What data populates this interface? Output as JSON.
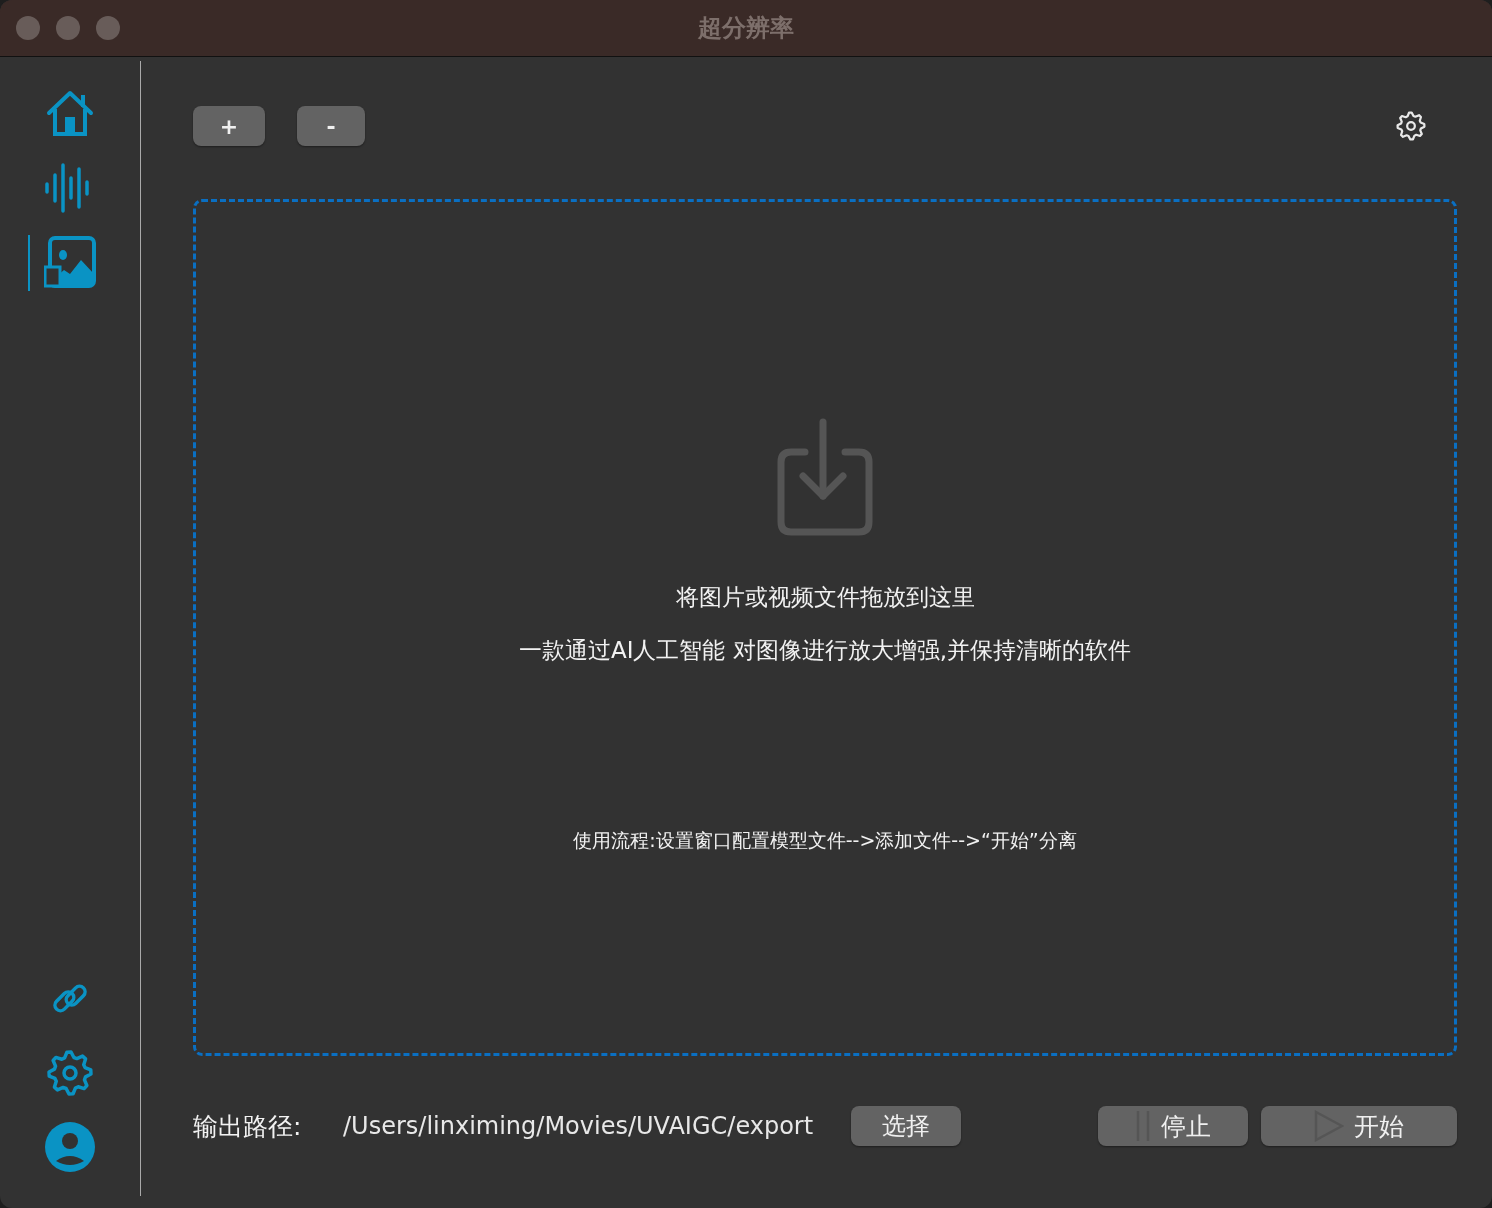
{
  "window": {
    "title": "超分辨率"
  },
  "sidebar": {
    "nav": [
      {
        "kind": "home",
        "selected": false
      },
      {
        "kind": "audio",
        "selected": false
      },
      {
        "kind": "image",
        "selected": true
      }
    ],
    "footer": [
      {
        "kind": "link"
      },
      {
        "kind": "settings"
      },
      {
        "kind": "account"
      }
    ]
  },
  "toolbar": {
    "buttons": [
      "+",
      "-"
    ]
  },
  "drop_zone": {
    "title": "将图片或视频文件拖放到这里",
    "subtitle": "一款通过AI人工智能 对图像进行放大增强,并保持清晰的软件",
    "hint": "使用流程:设置窗口配置模型文件-->添加文件-->“开始”分离"
  },
  "output": {
    "label": "输出路径:",
    "path": "/Users/linximing/Movies/UVAIGC/export",
    "choose_button": "选择"
  },
  "actions": [
    {
      "kind": "stop",
      "label": "停止"
    },
    {
      "kind": "start",
      "label": "开始"
    }
  ]
}
